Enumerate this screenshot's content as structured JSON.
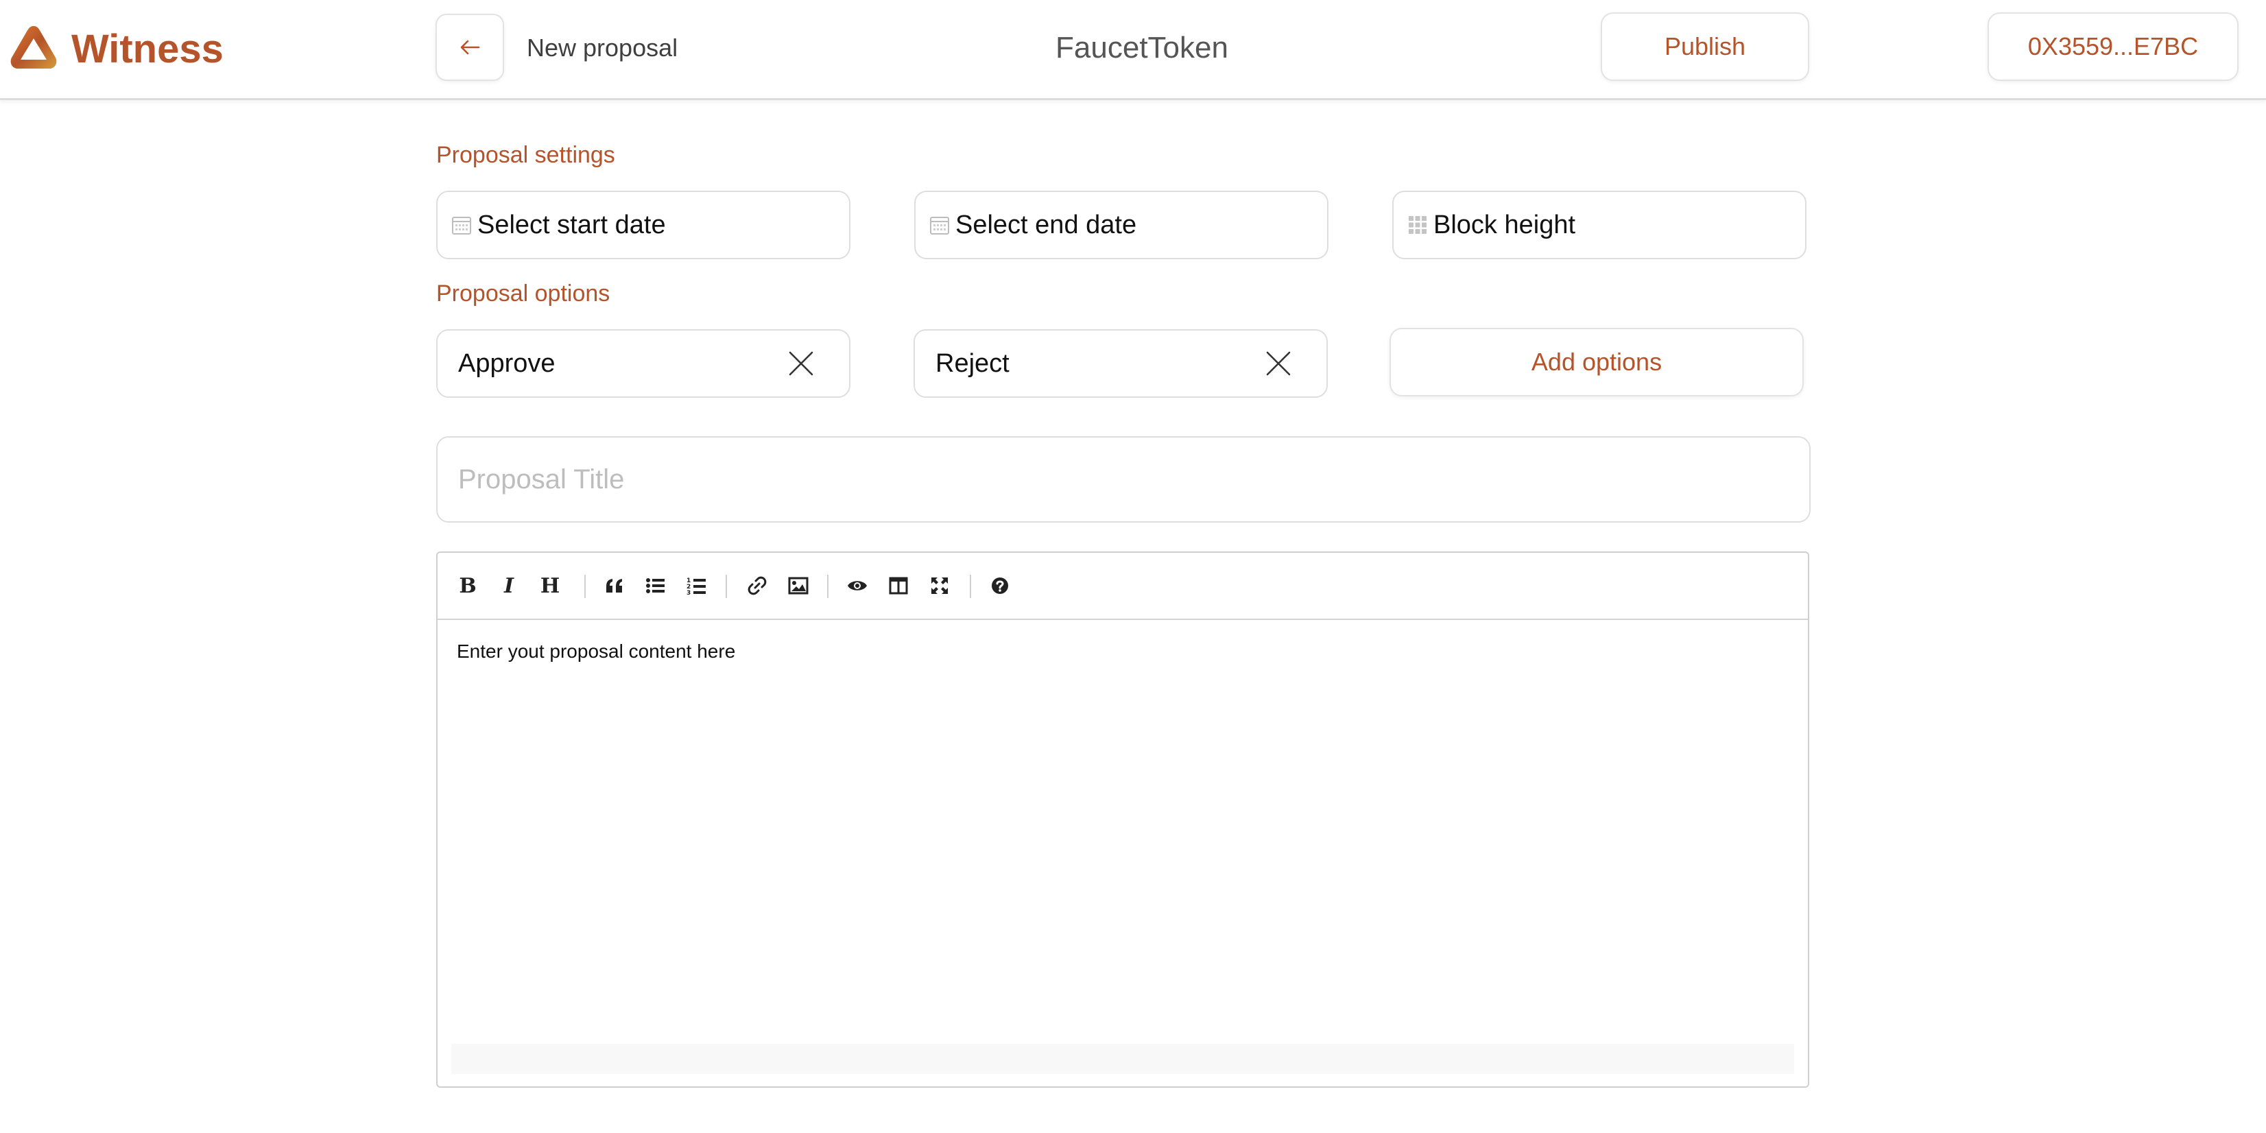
{
  "app": {
    "brand": "Witness",
    "accent_color": "#b5532a"
  },
  "header": {
    "back_icon": "arrow-left-icon",
    "breadcrumb": "New proposal",
    "space_title": "FaucetToken",
    "publish_label": "Publish",
    "wallet_address": "0X3559...E7BC"
  },
  "settings": {
    "label": "Proposal settings",
    "start_date": "Select start date",
    "end_date": "Select end date",
    "block_height": "Block height"
  },
  "options": {
    "label": "Proposal options",
    "items": [
      "Approve",
      "Reject"
    ],
    "add_label": "Add options"
  },
  "title_input": {
    "value": "",
    "placeholder": "Proposal Title"
  },
  "editor": {
    "toolbar": {
      "bold": "B",
      "italic": "I",
      "heading": "H"
    },
    "content": "Enter yout proposal content here"
  }
}
